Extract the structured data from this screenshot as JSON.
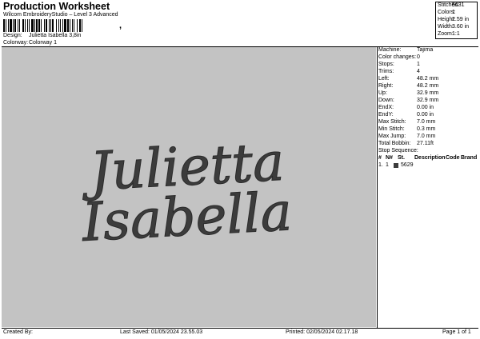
{
  "header": {
    "title": "Production Worksheet",
    "subtitle": "Wilcom EmbroideryStudio – Level 3 Advanced",
    "barcode_suffix": ","
  },
  "design_info": {
    "design_label": "Design:",
    "design_value": "Julietta Isabella 3,8in",
    "colorway_label": "Colorway:",
    "colorway_value": "Colorway 1"
  },
  "stats": {
    "stitches_label": "Stitches:",
    "stitches_value": "5631",
    "colors_label": "Colors:",
    "colors_value": "1",
    "height_label": "Height:",
    "height_value": "2.59 in",
    "width_label": "Width:",
    "width_value": "3.60 in",
    "zoom_label": "Zoom:",
    "zoom_value": "1:1"
  },
  "design_preview": {
    "line1": "Julietta",
    "line2": "Isabella",
    "thread_color": "#3c3c3c",
    "background_color": "#c3c3c3"
  },
  "machine_info": [
    {
      "label": "Machine:",
      "value": "Tajima"
    },
    {
      "label": "Color changes:",
      "value": "0"
    },
    {
      "label": "Stops:",
      "value": "1"
    },
    {
      "label": "Trims:",
      "value": "4"
    },
    {
      "label": "Left:",
      "value": "48.2 mm"
    },
    {
      "label": "Right:",
      "value": "48.2 mm"
    },
    {
      "label": "Up:",
      "value": "32.9 mm"
    },
    {
      "label": "Down:",
      "value": "32.9 mm"
    },
    {
      "label": "EndX:",
      "value": "0.00 in"
    },
    {
      "label": "EndY:",
      "value": "0.00 in"
    },
    {
      "label": "Max Stitch:",
      "value": "7.0 mm"
    },
    {
      "label": "Min Stitch:",
      "value": "0.3 mm"
    },
    {
      "label": "Max Jump:",
      "value": "7.0 mm"
    },
    {
      "label": "Total Bobbin:",
      "value": "27.11ft"
    }
  ],
  "stop_sequence": {
    "title": "Stop Sequence:",
    "columns": [
      "#",
      "N#",
      "St.",
      "Description",
      "Code",
      "Brand"
    ],
    "rows": [
      {
        "num": "1.",
        "needle": "1",
        "stitches": "5629",
        "description": "",
        "code": "",
        "brand": "",
        "color": "#3c3c3c"
      }
    ]
  },
  "footer": {
    "created_by": "Created By:",
    "last_saved": "Last Saved: 01/05/2024 23.55.03",
    "printed": "Printed: 02/05/2024 02.17.18",
    "page": "Page 1 of 1"
  }
}
